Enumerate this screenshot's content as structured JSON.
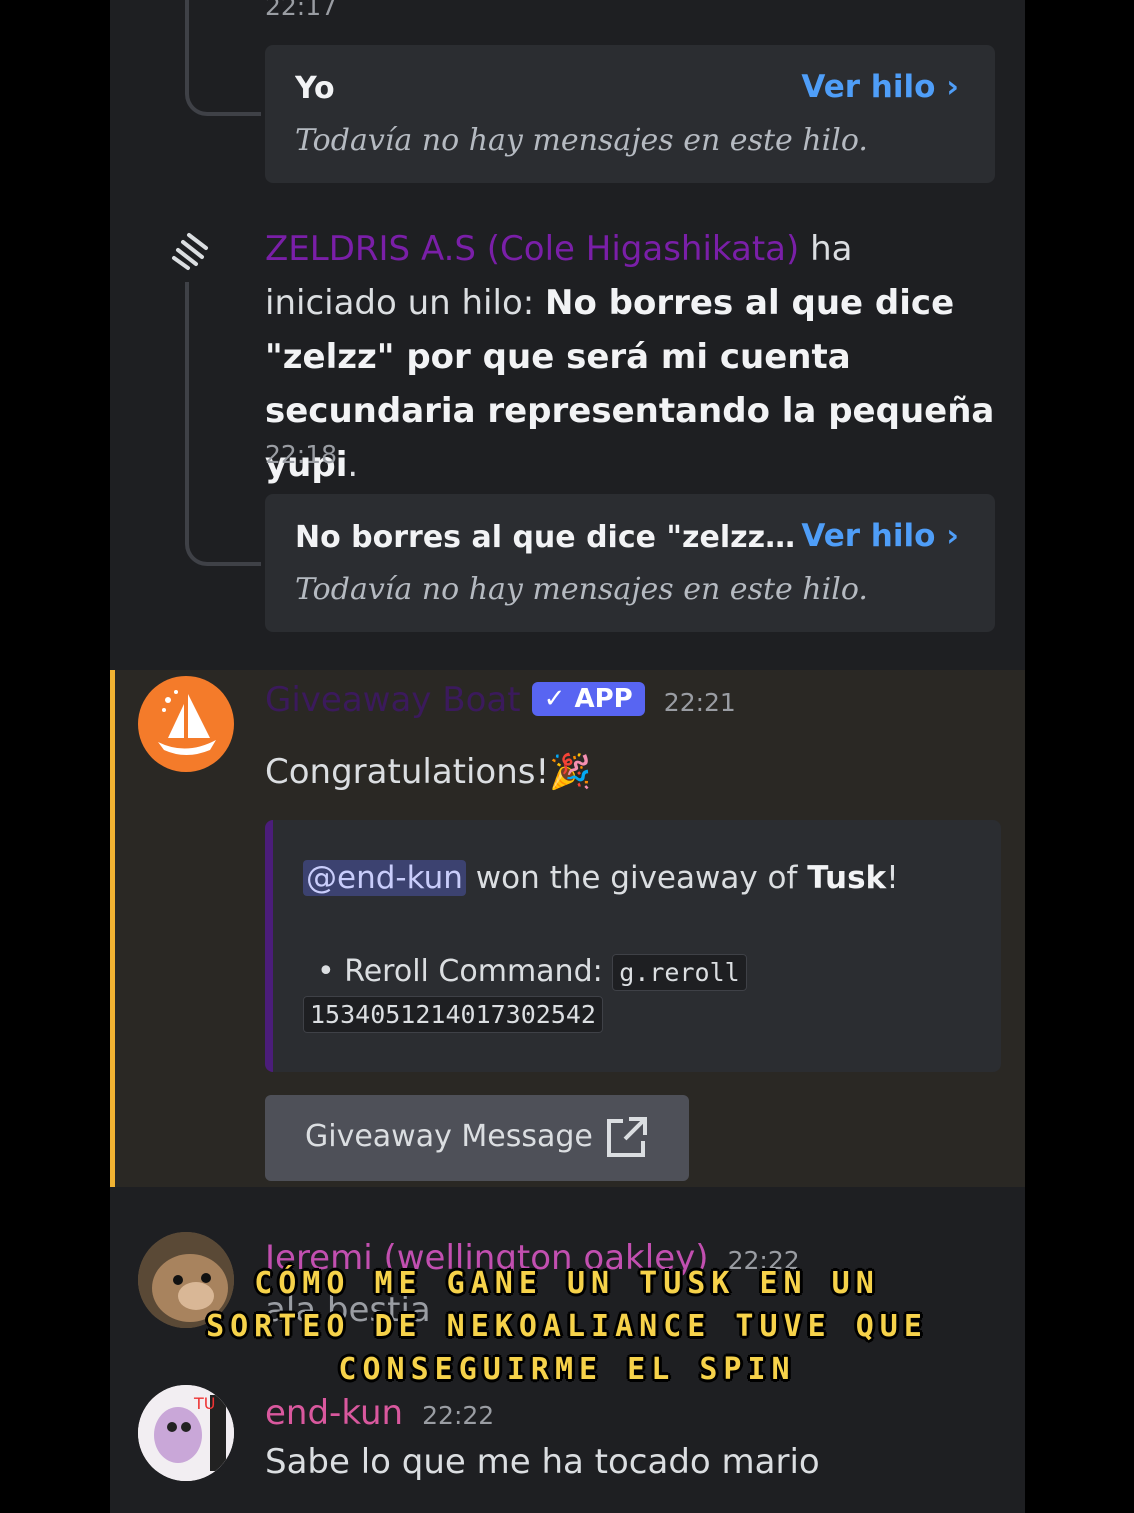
{
  "thread_top": {
    "timestamp": "22:17",
    "card_title": "Yo",
    "view_link": "Ver hilo ›",
    "empty_text": "Todavía no hay mensajes en este hilo."
  },
  "system_message": {
    "user": "ZELDRIS A.S (Cole Higashikata)",
    "action": "ha iniciado un hilo:",
    "thread_name": "No borres al que dice \"zelzz\" por que será mi cuenta secundaria representando la pequeña yupi",
    "period": ".",
    "timestamp": "22:18"
  },
  "thread_bottom": {
    "card_title": "No borres al que dice \"zelzz\" po...",
    "view_link": "Ver hilo ›",
    "empty_text": "Todavía no hay mensajes en este hilo."
  },
  "giveaway": {
    "bot_name": "Giveaway Boat",
    "badge": "✓ APP",
    "timestamp": "22:21",
    "message": "Congratulations!",
    "emoji": "🎉",
    "mention": "@end-kun",
    "won_text": "won the giveaway of",
    "prize": "Tusk",
    "exclaim": "!",
    "reroll_label": "• Reroll Command:",
    "reroll_cmd": "g.reroll",
    "reroll_id": "1534051214017302542",
    "button_label": "Giveaway Message"
  },
  "msg_jeremi": {
    "author": "Jeremi (wellington oakley)",
    "timestamp": "22:22",
    "text": "ala bestia"
  },
  "msg_endkun": {
    "author": "end-kun",
    "timestamp": "22:22",
    "text": "Sabe lo que me ha tocado mario"
  },
  "caption": {
    "line1": "CÓMO ME GANE UN TUSK EN UN",
    "line2": "SORTEO DE NEKOALIANCE TUVE QUE",
    "line3": "CONSEGUIRME EL SPIN"
  },
  "colors": {
    "background": "#1e1f22",
    "card": "#2b2d31",
    "link": "#4f9ef8",
    "highlight_bar": "#f0b232",
    "app_badge": "#5865f2",
    "caption": "#f6d24a"
  }
}
